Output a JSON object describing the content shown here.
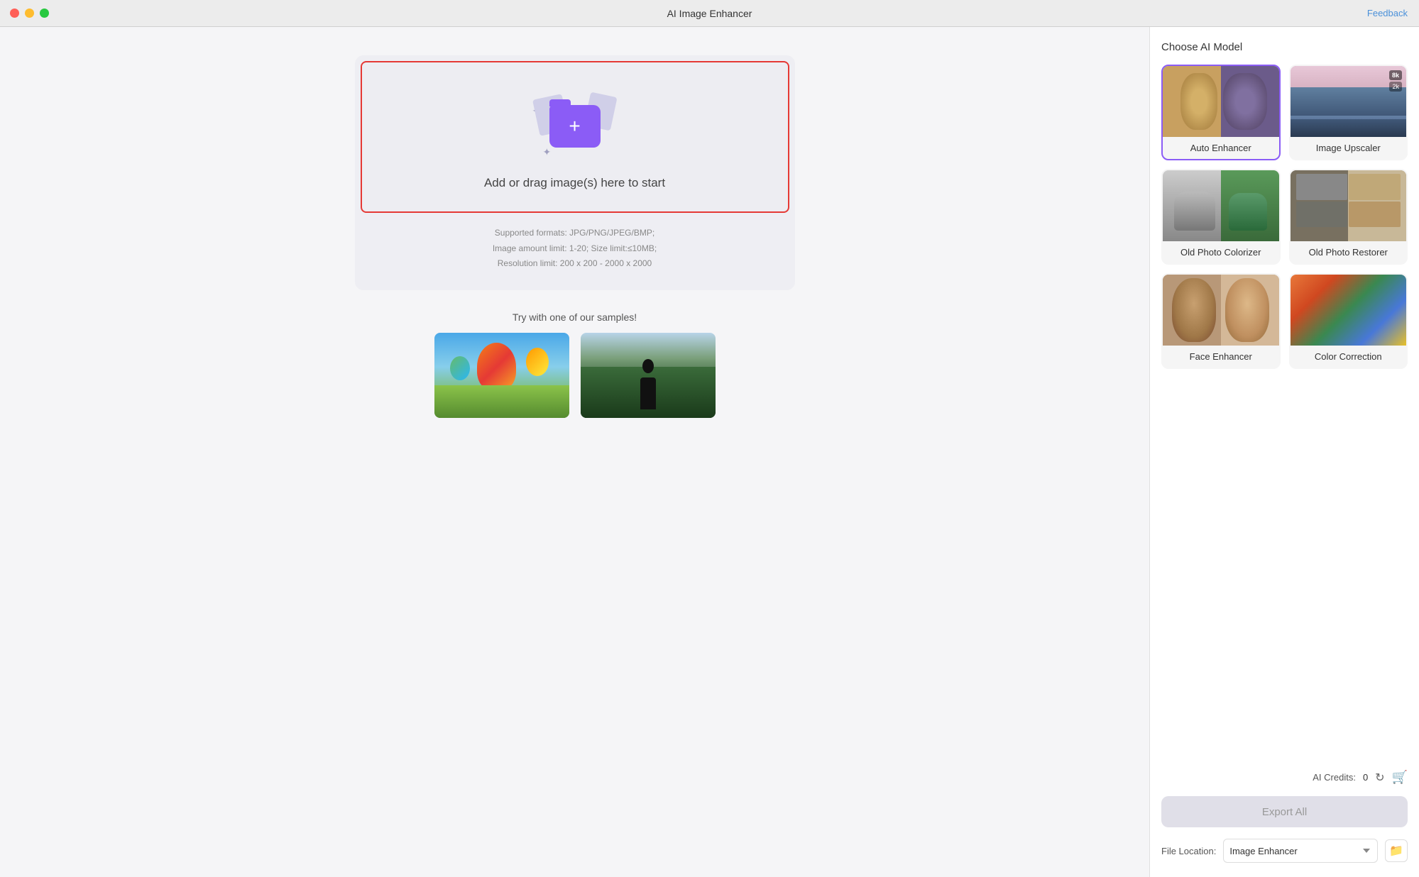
{
  "titleBar": {
    "title": "AI Image Enhancer",
    "feedbackLabel": "Feedback"
  },
  "rightPanel": {
    "chooseModelLabel": "Choose AI Model",
    "models": [
      {
        "id": "auto-enhancer",
        "label": "Auto Enhancer",
        "selected": true
      },
      {
        "id": "image-upscaler",
        "label": "Image Upscaler",
        "selected": false
      },
      {
        "id": "old-photo-colorizer",
        "label": "Old Photo Colorizer",
        "selected": false
      },
      {
        "id": "old-photo-restorer",
        "label": "Old Photo Restorer",
        "selected": false
      },
      {
        "id": "face-enhancer",
        "label": "Face Enhancer",
        "selected": false
      },
      {
        "id": "color-correction",
        "label": "Color Correction",
        "selected": false
      }
    ],
    "upscalerBadge1": "8k",
    "upscalerBadge2": "2k",
    "creditsLabel": "AI Credits:",
    "creditsValue": "0",
    "exportAllLabel": "Export All",
    "fileLocationLabel": "File Location:",
    "fileLocationOptions": [
      "Image Enhancer"
    ],
    "fileLocationSelected": "Image Enhancer"
  },
  "uploadArea": {
    "dragText": "Add or drag image(s) here to start",
    "infoLine1": "Supported formats: JPG/PNG/JPEG/BMP;",
    "infoLine2": "Image amount limit: 1-20; Size limit:≤10MB;",
    "infoLine3": "Resolution limit: 200 x 200 - 2000 x 2000"
  },
  "samplesSection": {
    "title": "Try with one of our samples!",
    "samples": [
      {
        "id": "balloons",
        "alt": "Hot air balloons"
      },
      {
        "id": "forest",
        "alt": "Person in forest"
      }
    ]
  },
  "bottomLabel": "Image Enhancer"
}
